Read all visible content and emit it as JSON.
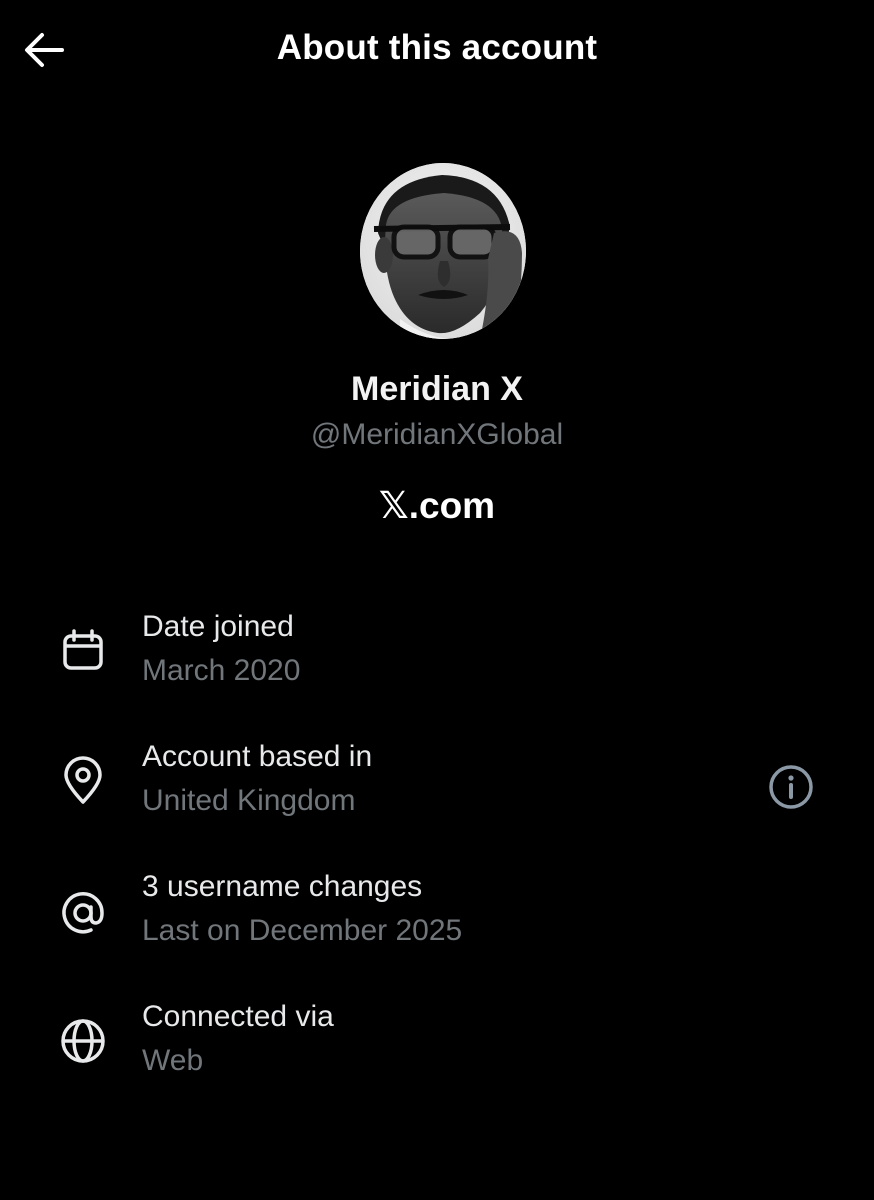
{
  "header": {
    "back_icon": "arrow-left-icon",
    "title": "About this account"
  },
  "profile": {
    "avatar": "profile-photo",
    "display_name": "Meridian X",
    "handle": "@MeridianXGlobal",
    "site": "𝕏.com"
  },
  "details": [
    {
      "icon": "calendar-icon",
      "title": "Date joined",
      "value": "March 2020"
    },
    {
      "icon": "location-pin-icon",
      "title": "Account based in",
      "value": "United Kingdom",
      "action_icon": "info-icon"
    },
    {
      "icon": "at-sign-icon",
      "title": "3 username changes",
      "value": "Last on December 2025"
    },
    {
      "icon": "globe-icon",
      "title": "Connected via",
      "value": "Web"
    }
  ],
  "colors": {
    "background": "#000000",
    "primary_text": "#e7e9ea",
    "secondary_text": "#71767b"
  }
}
